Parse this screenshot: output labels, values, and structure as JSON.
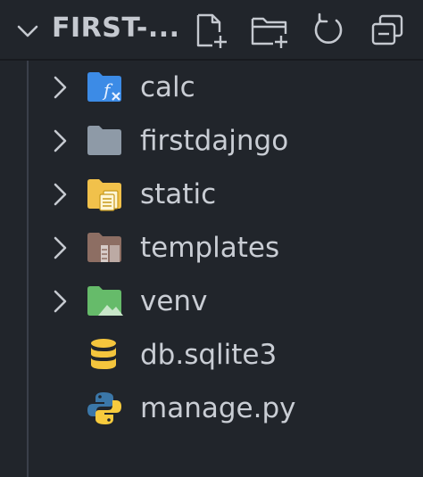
{
  "explorer": {
    "title": "FIRST-...",
    "actions": [
      {
        "name": "new-file-icon"
      },
      {
        "name": "new-folder-icon"
      },
      {
        "name": "refresh-icon"
      },
      {
        "name": "collapse-all-icon"
      }
    ]
  },
  "tree": {
    "items": [
      {
        "label": "calc",
        "type": "folder",
        "icon": "folder-function-icon",
        "color": "#3c8be6"
      },
      {
        "label": "firstdajngo",
        "type": "folder",
        "icon": "folder-icon",
        "color": "#8e9aa7"
      },
      {
        "label": "static",
        "type": "folder",
        "icon": "folder-static-icon",
        "color": "#f1c14b"
      },
      {
        "label": "templates",
        "type": "folder",
        "icon": "folder-templates-icon",
        "color": "#8d6e63"
      },
      {
        "label": "venv",
        "type": "folder",
        "icon": "folder-environment-icon",
        "color": "#66bb6a"
      },
      {
        "label": "db.sqlite3",
        "type": "file",
        "icon": "database-icon",
        "color": "#f4c53d"
      },
      {
        "label": "manage.py",
        "type": "file",
        "icon": "python-icon",
        "color": "#3b77a8"
      }
    ]
  }
}
